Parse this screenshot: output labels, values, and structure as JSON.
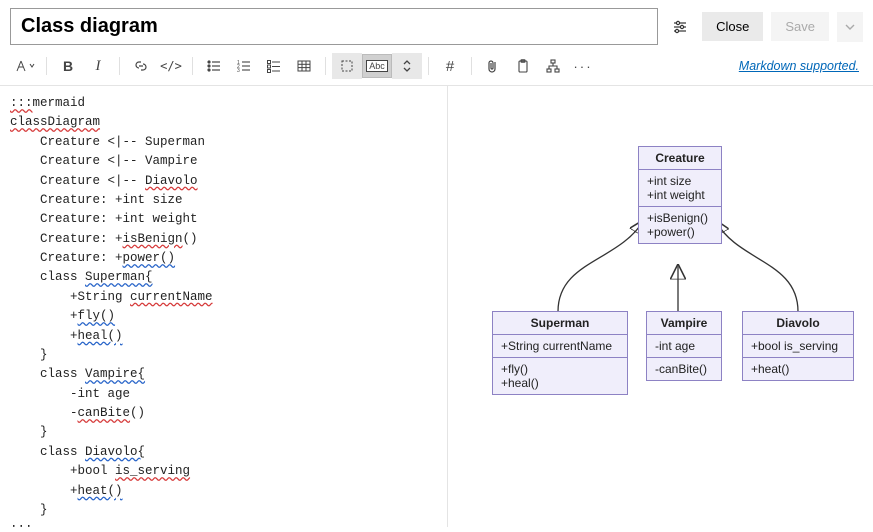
{
  "header": {
    "title_value": "Class diagram",
    "close_label": "Close",
    "save_label": "Save"
  },
  "toolbar": {
    "markdown_link": "Markdown supported."
  },
  "source": {
    "l0": ":::",
    "l0b": "mermaid",
    "l1": "classDiagram",
    "l2": "    Creature <|-- Superman",
    "l3": "    Creature <|-- Vampire",
    "l4": "    Creature <|-- ",
    "l4b": "Diavolo",
    "l5": "    Creature: +int size",
    "l6": "    Creature: +int weight",
    "l7a": "    Creature: +",
    "l7b": "isBenign",
    "l7c": "()",
    "l8a": "    Creature: +",
    "l8b": "power()",
    "l9a": "    class ",
    "l9b": "Superman{",
    "l10a": "        +String ",
    "l10b": "currentName",
    "l11a": "        +",
    "l11b": "fly()",
    "l12a": "        +",
    "l12b": "heal()",
    "l13": "    }",
    "l14a": "    class ",
    "l14b": "Vampire{",
    "l15": "        -int age",
    "l16a": "        -",
    "l16b": "canBite",
    "l16c": "()",
    "l17": "    }",
    "l18a": "    class ",
    "l18b": "Diavolo{",
    "l19a": "        +bool ",
    "l19b": "is_serving",
    "l20a": "        +",
    "l20b": "heat()",
    "l21": "    }",
    "l22": ":::"
  },
  "chart_data": {
    "type": "class-diagram",
    "classes": {
      "Creature": {
        "name": "Creature",
        "attrs": [
          "+int size",
          "+int weight"
        ],
        "methods": [
          "+isBenign()",
          "+power()"
        ]
      },
      "Superman": {
        "name": "Superman",
        "attrs": [
          "+String currentName"
        ],
        "methods": [
          "+fly()",
          "+heal()"
        ]
      },
      "Vampire": {
        "name": "Vampire",
        "attrs": [
          "-int age"
        ],
        "methods": [
          "-canBite()"
        ]
      },
      "Diavolo": {
        "name": "Diavolo",
        "attrs": [
          "+bool is_serving"
        ],
        "methods": [
          "+heat()"
        ]
      }
    },
    "edges": [
      {
        "from": "Superman",
        "to": "Creature",
        "type": "inherit"
      },
      {
        "from": "Vampire",
        "to": "Creature",
        "type": "inherit"
      },
      {
        "from": "Diavolo",
        "to": "Creature",
        "type": "inherit"
      }
    ]
  },
  "diagram": {
    "creature": {
      "name": "Creature",
      "a0": "+int size",
      "a1": "+int weight",
      "m0": "+isBenign()",
      "m1": "+power()"
    },
    "superman": {
      "name": "Superman",
      "a0": "+String currentName",
      "m0": "+fly()",
      "m1": "+heal()"
    },
    "vampire": {
      "name": "Vampire",
      "a0": "-int age",
      "m0": "-canBite()"
    },
    "diavolo": {
      "name": "Diavolo",
      "a0": "+bool is_serving",
      "m0": "+heat()"
    }
  }
}
